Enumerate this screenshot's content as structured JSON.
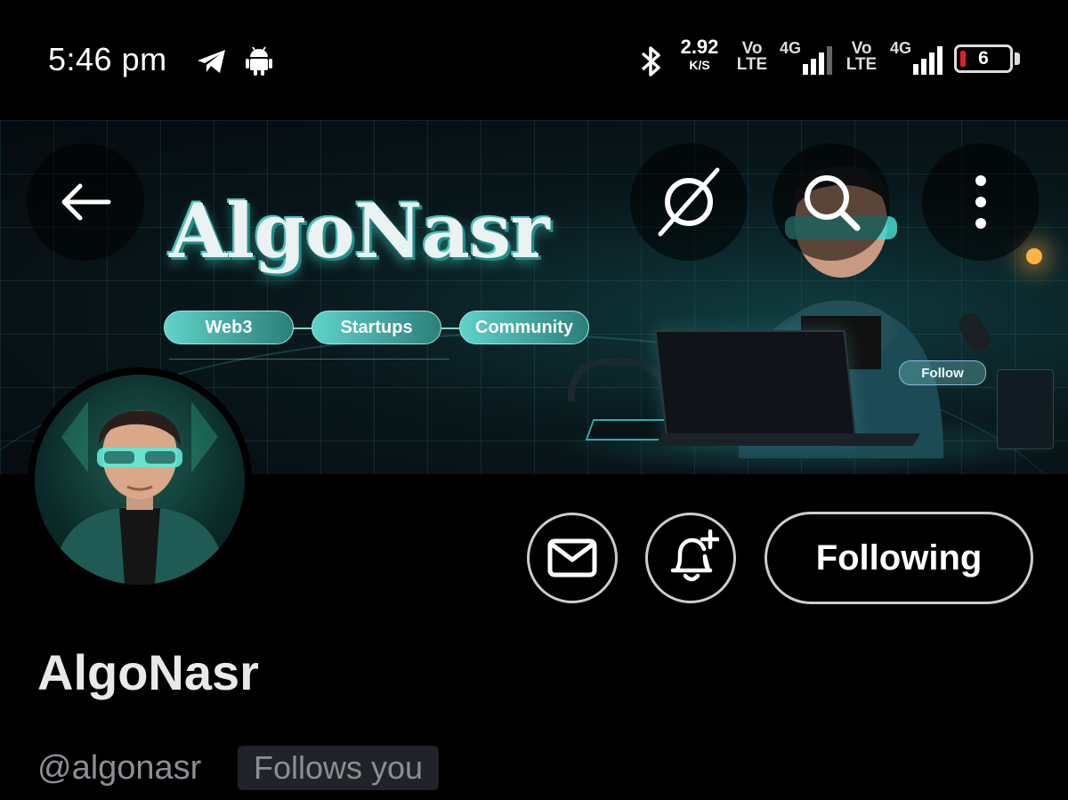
{
  "status_bar": {
    "time": "5:46 pm",
    "net_speed_value": "2.92",
    "net_speed_unit": "K/S",
    "volte_1_top": "Vo",
    "volte_1_bottom": "LTE",
    "sim1_network": "4G",
    "volte_2_top": "Vo",
    "volte_2_bottom": "LTE",
    "sim2_network": "4G",
    "battery_level": "6",
    "icons": [
      "telegram-icon",
      "android-icon",
      "bluetooth-icon",
      "signal-icon",
      "battery-icon"
    ]
  },
  "banner": {
    "brand": "AlgoNasr",
    "pills": [
      "Web3",
      "Startups",
      "Community"
    ],
    "follow_chip": "Follow",
    "accent_color": "#3ec7bd"
  },
  "header_buttons": {
    "back": "back-arrow-icon",
    "grok": "grok-icon",
    "search": "search-icon",
    "more": "more-vertical-icon"
  },
  "profile": {
    "display_name": "AlgoNasr",
    "handle": "@algonasr",
    "follows_you": "Follows you",
    "following_label": "Following"
  }
}
